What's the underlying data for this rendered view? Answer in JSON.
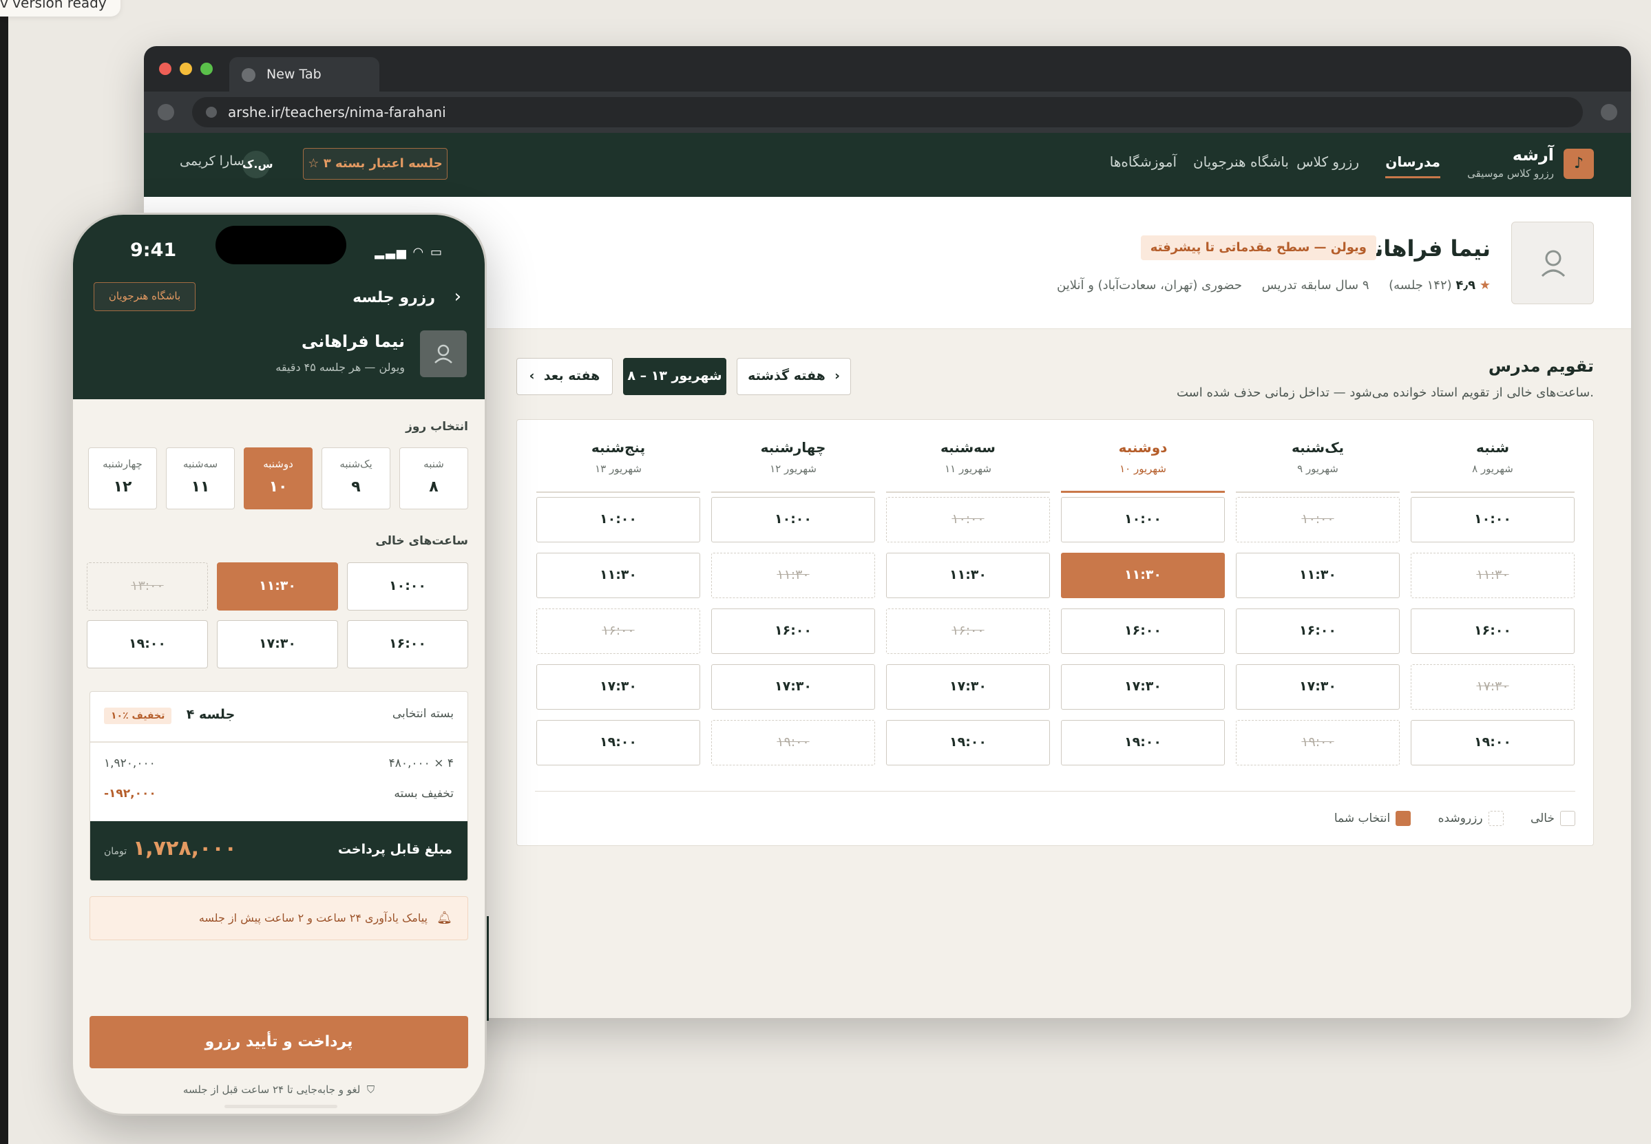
{
  "toast": "v version ready",
  "browser": {
    "tab_title": "New Tab",
    "url": "arshe.ir/teachers/nima-farahani"
  },
  "site": {
    "brand": "آرشه",
    "tagline": "رزرو کلاس موسیقی",
    "nav": [
      "مدرسان",
      "رزرو کلاس",
      "باشگاه هنرجویان",
      "آموزشگاه‌ها"
    ],
    "credit_label": "۳ جلسه اعتبار بسته",
    "user_name": "سارا کریمی",
    "user_initials": "س.ک"
  },
  "teacher": {
    "name": "نیما فراهانی",
    "badge": "ویولن — سطح مقدماتی تا پیشرفته",
    "rating": "۴٫۹",
    "sessions": "(۱۴۲ جلسه)",
    "experience": "۹ سال سابقه تدریس",
    "mode": "حضوری (تهران، سعادت‌آباد) و آنلاین"
  },
  "calendar": {
    "title": "تقویم مدرس",
    "subtitle": "ساعت‌های خالی از تقویم استاد خوانده می‌شود — تداخل زمانی حذف شده است.",
    "prev_week": "هفته گذشته",
    "current_week": "۸ – ۱۳ شهریور",
    "next_week": "هفته بعد",
    "days": [
      {
        "name": "شنبه",
        "date": "۸ شهریور",
        "slots": [
          {
            "t": "۱۰:۰۰",
            "s": "free"
          },
          {
            "t": "۱۱:۳۰",
            "s": "booked"
          },
          {
            "t": "۱۶:۰۰",
            "s": "free"
          },
          {
            "t": "۱۷:۳۰",
            "s": "booked"
          },
          {
            "t": "۱۹:۰۰",
            "s": "free"
          }
        ]
      },
      {
        "name": "یک‌شنبه",
        "date": "۹ شهریور",
        "slots": [
          {
            "t": "۱۰:۰۰",
            "s": "booked"
          },
          {
            "t": "۱۱:۳۰",
            "s": "free"
          },
          {
            "t": "۱۶:۰۰",
            "s": "free"
          },
          {
            "t": "۱۷:۳۰",
            "s": "free"
          },
          {
            "t": "۱۹:۰۰",
            "s": "booked"
          }
        ]
      },
      {
        "name": "دوشنبه",
        "date": "۱۰ شهریور",
        "selected": true,
        "slots": [
          {
            "t": "۱۰:۰۰",
            "s": "free"
          },
          {
            "t": "۱۱:۳۰",
            "s": "chosen"
          },
          {
            "t": "۱۶:۰۰",
            "s": "free"
          },
          {
            "t": "۱۷:۳۰",
            "s": "free"
          },
          {
            "t": "۱۹:۰۰",
            "s": "free"
          }
        ]
      },
      {
        "name": "سه‌شنبه",
        "date": "۱۱ شهریور",
        "slots": [
          {
            "t": "۱۰:۰۰",
            "s": "booked"
          },
          {
            "t": "۱۱:۳۰",
            "s": "free"
          },
          {
            "t": "۱۶:۰۰",
            "s": "booked"
          },
          {
            "t": "۱۷:۳۰",
            "s": "free"
          },
          {
            "t": "۱۹:۰۰",
            "s": "free"
          }
        ]
      },
      {
        "name": "چهارشنبه",
        "date": "۱۲ شهریور",
        "slots": [
          {
            "t": "۱۰:۰۰",
            "s": "free"
          },
          {
            "t": "۱۱:۳۰",
            "s": "booked"
          },
          {
            "t": "۱۶:۰۰",
            "s": "free"
          },
          {
            "t": "۱۷:۳۰",
            "s": "free"
          },
          {
            "t": "۱۹:۰۰",
            "s": "booked"
          }
        ]
      },
      {
        "name": "پنج‌شنبه",
        "date": "۱۳ شهریور",
        "slots": [
          {
            "t": "۱۰:۰۰",
            "s": "free"
          },
          {
            "t": "۱۱:۳۰",
            "s": "free"
          },
          {
            "t": "۱۶:۰۰",
            "s": "booked"
          },
          {
            "t": "۱۷:۳۰",
            "s": "free"
          },
          {
            "t": "۱۹:۰۰",
            "s": "free"
          }
        ]
      }
    ],
    "legend": {
      "free": "خالی",
      "booked": "رزروشده",
      "chosen": "انتخاب شما"
    }
  },
  "phone": {
    "time": "9:41",
    "title": "رزرو جلسه",
    "club_button": "باشگاه هنرجویان",
    "teacher_name": "نیما فراهانی",
    "teacher_sub": "ویولن — هر جلسه ۴۵ دقیقه",
    "day_label": "انتخاب روز",
    "days": [
      {
        "a": "شنبه",
        "b": "۸"
      },
      {
        "a": "یک‌شنبه",
        "b": "۹"
      },
      {
        "a": "دوشنبه",
        "b": "۱۰",
        "selected": true
      },
      {
        "a": "سه‌شنبه",
        "b": "۱۱"
      },
      {
        "a": "چهارشنبه",
        "b": "۱۲"
      }
    ],
    "times_label": "ساعت‌های خالی",
    "times": [
      {
        "t": "۱۰:۰۰",
        "s": "free"
      },
      {
        "t": "۱۱:۳۰",
        "s": "chosen"
      },
      {
        "t": "۱۳:۰۰",
        "s": "booked"
      },
      {
        "t": "۱۶:۰۰",
        "s": "free"
      },
      {
        "t": "۱۷:۳۰",
        "s": "free"
      },
      {
        "t": "۱۹:۰۰",
        "s": "free"
      }
    ],
    "package_label": "بسته انتخابی",
    "package_value": "۴ جلسه",
    "package_discount": "۱۰٪ تخفیف",
    "line1_label": "۴ × ۴۸۰,۰۰۰",
    "line1_value": "۱,۹۲۰,۰۰۰",
    "line2_label": "تخفیف بسته",
    "line2_value": "-۱۹۲,۰۰۰",
    "total_label": "مبلغ قابل پرداخت",
    "total_value": "۱,۷۲۸,۰۰۰",
    "currency": "تومان",
    "reminder": "پیامک یادآوری ۲۴ ساعت و ۲ ساعت پیش از جلسه",
    "confirm": "پرداخت و تأیید رزرو",
    "cancel_note": "لغو و جابه‌جایی تا ۲۴ ساعت قبل از جلسه"
  }
}
